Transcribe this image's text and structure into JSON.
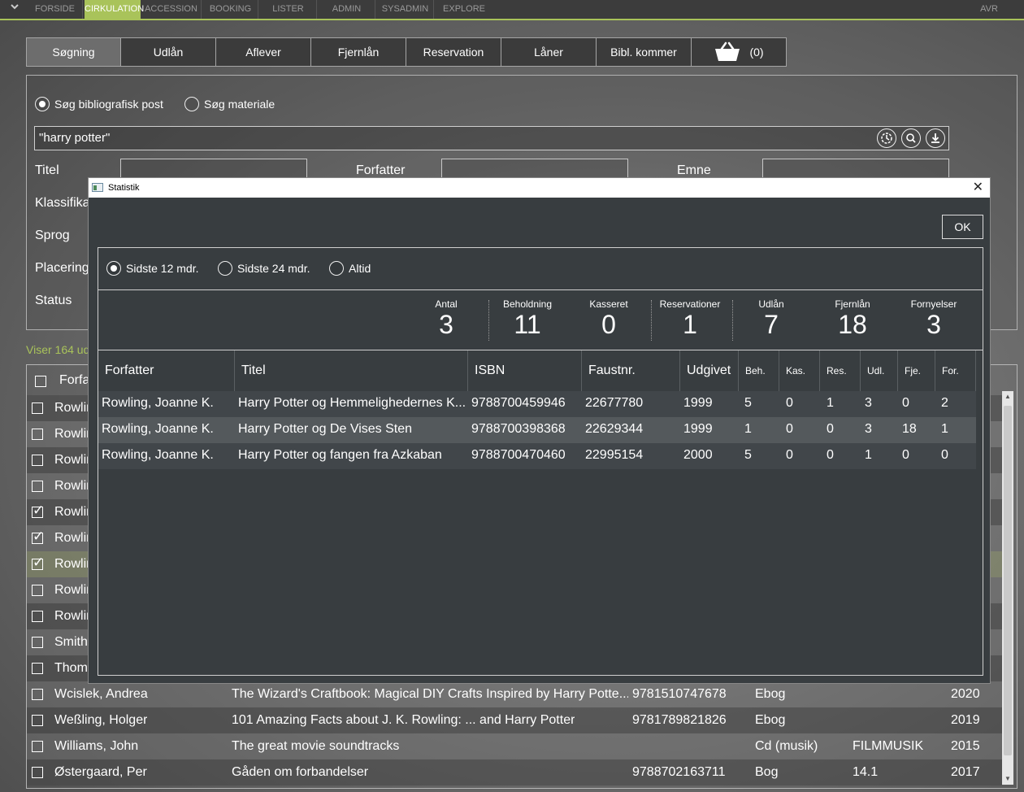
{
  "topmenu": {
    "items": [
      "FORSIDE",
      "CIRKULATION",
      "ACCESSION",
      "BOOKING",
      "LISTER",
      "ADMIN",
      "SYSADMIN",
      "EXPLORE"
    ],
    "active": "CIRKULATION",
    "user": "AVR",
    "accent": "#a9c35a"
  },
  "tabs": [
    "Søgning",
    "Udlån",
    "Aflever",
    "Fjernlån",
    "Reservation",
    "Låner",
    "Bibl. kommer"
  ],
  "basket": {
    "icon": "basket-icon",
    "count": "(0)"
  },
  "search": {
    "radio_bib": "Søg bibliografisk post",
    "radio_mat": "Søg materiale",
    "query": "\"harry potter\"",
    "icons": [
      "history-icon",
      "search-icon",
      "download-icon"
    ]
  },
  "fields": {
    "titel": "Titel",
    "forfatter": "Forfatter",
    "emne": "Emne",
    "klassifikation": "Klassifika",
    "sprog": "Sprog",
    "placering": "Placering",
    "status": "Status"
  },
  "results": {
    "showing": "Viser 164 ud",
    "header_col": "Forfa",
    "rows": [
      {
        "checked": false,
        "author": "Rowlir",
        "title": "",
        "isbn": "",
        "type": "",
        "class": "",
        "year": ""
      },
      {
        "checked": false,
        "author": "Rowlir",
        "title": "",
        "isbn": "",
        "type": "",
        "class": "",
        "year": ""
      },
      {
        "checked": false,
        "author": "Rowlir",
        "title": "",
        "isbn": "",
        "type": "",
        "class": "",
        "year": ""
      },
      {
        "checked": false,
        "author": "Rowlir",
        "title": "",
        "isbn": "",
        "type": "",
        "class": "",
        "year": ""
      },
      {
        "checked": true,
        "author": "Rowlir",
        "title": "",
        "isbn": "",
        "type": "",
        "class": "",
        "year": ""
      },
      {
        "checked": true,
        "author": "Rowlir",
        "title": "",
        "isbn": "",
        "type": "",
        "class": "",
        "year": ""
      },
      {
        "checked": true,
        "author": "Rowlir",
        "title": "",
        "isbn": "",
        "type": "",
        "class": "",
        "year": ""
      },
      {
        "checked": false,
        "author": "Rowlir",
        "title": "",
        "isbn": "",
        "type": "",
        "class": "",
        "year": ""
      },
      {
        "checked": false,
        "author": "Rowlir",
        "title": "",
        "isbn": "",
        "type": "",
        "class": "",
        "year": ""
      },
      {
        "checked": false,
        "author": "Smith",
        "title": "",
        "isbn": "",
        "type": "",
        "class": "",
        "year": ""
      },
      {
        "checked": false,
        "author": "Thom",
        "title": "",
        "isbn": "",
        "type": "",
        "class": "",
        "year": ""
      },
      {
        "checked": false,
        "author": "Wcislek, Andrea",
        "title": "The Wizard's Craftbook: Magical DIY Crafts Inspired by Harry Potte...",
        "isbn": "9781510747678",
        "type": "Ebog",
        "class": "",
        "year": "2020"
      },
      {
        "checked": false,
        "author": "Weßling, Holger",
        "title": "101 Amazing Facts about J. K. Rowling: ... and Harry Potter",
        "isbn": "9781789821826",
        "type": "Ebog",
        "class": "",
        "year": "2019"
      },
      {
        "checked": false,
        "author": "Williams, John",
        "title": "The great movie soundtracks",
        "isbn": "",
        "type": "Cd (musik)",
        "class": "FILMMUSIK",
        "year": "2015"
      },
      {
        "checked": false,
        "author": "Østergaard, Per",
        "title": "Gåden om forbandelser",
        "isbn": "9788702163711",
        "type": "Bog",
        "class": "14.1",
        "year": "2017"
      }
    ]
  },
  "dialog": {
    "title": "Statistik",
    "ok": "OK",
    "periods": [
      "Sidste 12 mdr.",
      "Sidste 24 mdr.",
      "Altid"
    ],
    "selected_period": "Sidste 12 mdr.",
    "stats": [
      {
        "label": "Antal",
        "value": "3"
      },
      {
        "label": "Beholdning",
        "value": "11"
      },
      {
        "label": "Kasseret",
        "value": "0"
      },
      {
        "label": "Reservationer",
        "value": "1"
      },
      {
        "label": "Udlån",
        "value": "7"
      },
      {
        "label": "Fjernlån",
        "value": "18"
      },
      {
        "label": "Fornyelser",
        "value": "3"
      }
    ],
    "columns": [
      "Forfatter",
      "Titel",
      "ISBN",
      "Faustnr.",
      "Udgivet",
      "Beh.",
      "Kas.",
      "Res.",
      "Udl.",
      "Fje.",
      "For."
    ],
    "rows": [
      [
        "Rowling, Joanne K.",
        "Harry Potter og Hemmelighedernes K...",
        "9788700459946",
        "22677780",
        "1999",
        "5",
        "0",
        "1",
        "3",
        "0",
        "2"
      ],
      [
        "Rowling, Joanne K.",
        "Harry Potter og De Vises Sten",
        "9788700398368",
        "22629344",
        "1999",
        "1",
        "0",
        "0",
        "3",
        "18",
        "1"
      ],
      [
        "Rowling, Joanne K.",
        "Harry Potter og fangen fra Azkaban",
        "9788700470460",
        "22995154",
        "2000",
        "5",
        "0",
        "0",
        "1",
        "0",
        "0"
      ]
    ]
  }
}
